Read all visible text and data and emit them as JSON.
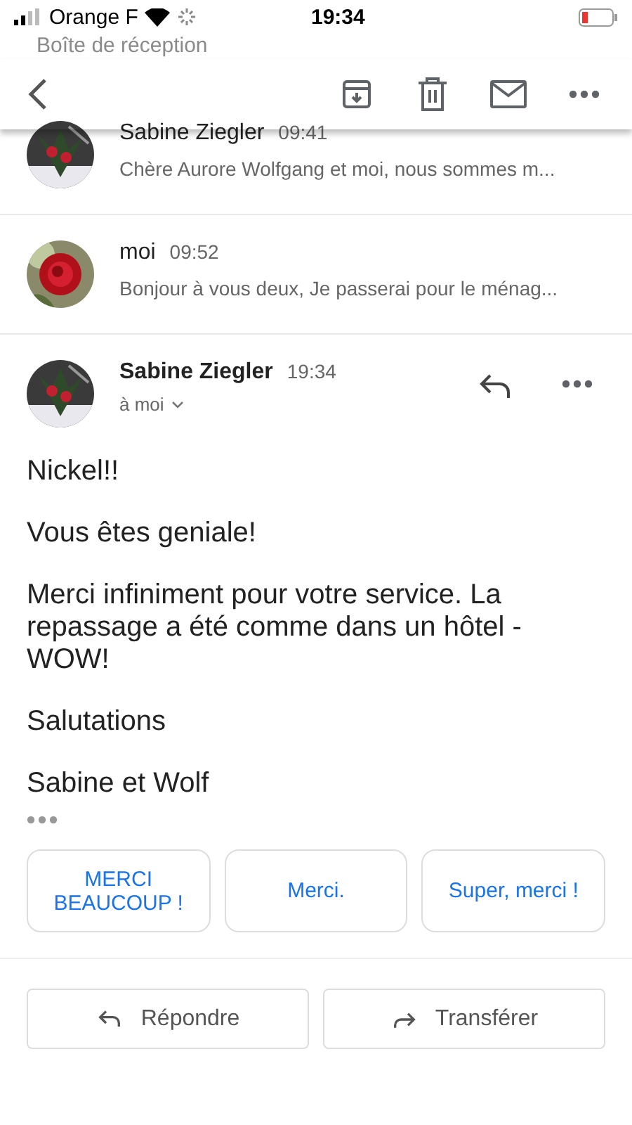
{
  "status_bar": {
    "carrier": "Orange F",
    "time": "19:34"
  },
  "back_label": "Boîte de réception",
  "thread": [
    {
      "sender": "Sabine Ziegler",
      "time": "09:41",
      "snippet": "Chère Aurore Wolfgang et moi, nous sommes m..."
    },
    {
      "sender": "moi",
      "time": "09:52",
      "snippet": "Bonjour à vous deux, Je passerai pour le ménag..."
    }
  ],
  "message": {
    "sender": "Sabine Ziegler",
    "time": "19:34",
    "recipient": "à moi",
    "body": [
      "Nickel!!",
      "Vous êtes geniale!",
      "Merci infiniment pour votre service. La repassage a été comme dans un hôtel - WOW!",
      "Salutations",
      "Sabine et Wolf"
    ]
  },
  "smart_replies": [
    "MERCI BEAUCOUP !",
    "Merci.",
    "Super, merci !"
  ],
  "actions": [
    {
      "kind": "reply",
      "label": "Répondre"
    },
    {
      "kind": "forward",
      "label": "Transférer"
    }
  ]
}
